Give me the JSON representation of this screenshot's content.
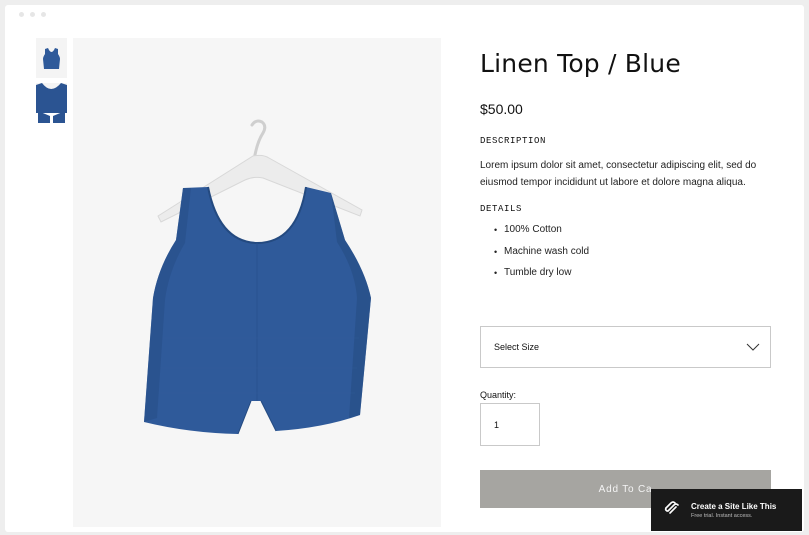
{
  "product": {
    "title": "Linen Top / Blue",
    "price": "$50.00",
    "description_heading": "DESCRIPTION",
    "description": "Lorem ipsum dolor sit amet, consectetur adipiscing elit, sed do eiusmod tempor incididunt ut labore et dolore magna aliqua.",
    "details_heading": "DETAILS",
    "details": [
      "100% Cotton",
      "Machine wash cold",
      "Tumble dry low"
    ]
  },
  "purchase": {
    "size_select_value": "Select Size",
    "quantity_label": "Quantity:",
    "quantity_value": "1",
    "add_to_cart_label": "Add To Ca"
  },
  "promo": {
    "title": "Create a Site Like This",
    "subtitle": "Free trial. Instant access."
  },
  "colors": {
    "garment": "#2f5a9a",
    "button_disabled": "#a6a5a1",
    "promo_bg": "#1a1a1a"
  },
  "icons": [
    "chevron-down-icon",
    "squarespace-logo-icon"
  ]
}
